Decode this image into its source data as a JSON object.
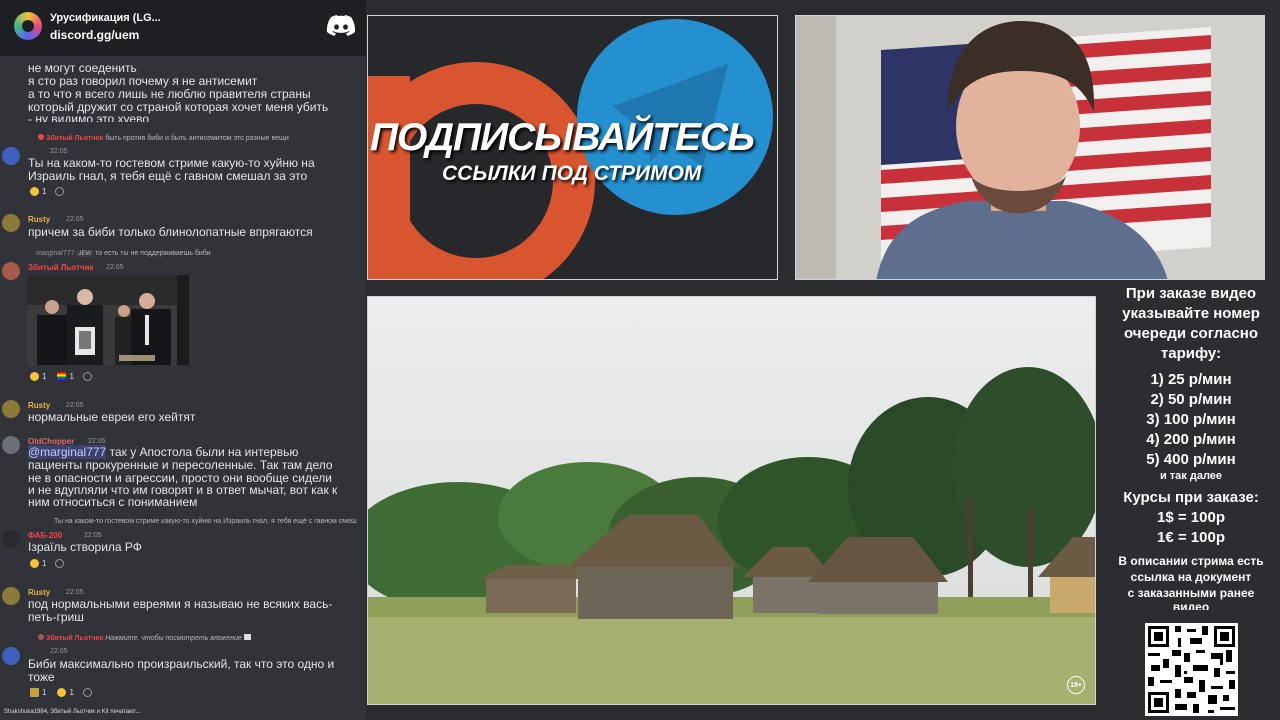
{
  "server": {
    "name": "Урусификация (LG...",
    "invite": "discord.gg/uem"
  },
  "chat": {
    "top_lines": [
      "не могут соеденить",
      "я сто раз говорил почему я не антисемит",
      "а то что я всего лишь не люблю правителя страны",
      "который дружит со страной которая хочет меня убить",
      "- ну видимо это хуево"
    ],
    "m1": {
      "reply_author": "Збитый Льотчик",
      "reply": "быть против биби и быть антисемитом это разные вещи",
      "time": "22:05",
      "lines": [
        "Ты на каком-то гостевом стриме какую-то хуйню на",
        "Израиль гнал, я тебя ещё с гавном смешал за это"
      ],
      "react_count": "1"
    },
    "m2": {
      "author": "Rusty",
      "time": "22:05",
      "text": "причем за биби только блинолопатные впрягаются"
    },
    "m3": {
      "reply_author": "marginal777",
      "reply_tag": "JEW",
      "reply": "то есть ты не поддерживаешь биби",
      "author": "Збитый Льотчик",
      "time": "22:05",
      "react1": "1",
      "react2": "1"
    },
    "m4": {
      "author": "Rusty",
      "time": "22:05",
      "text": "нормальные евреи его хейтят"
    },
    "m5": {
      "author": "OldChopper",
      "time": "22:05",
      "mention": "@marginal777",
      "lines_first": " так у Апостола были на интервью",
      "lines": [
        "пациенты прокуренные и пересоленные. Так там дело",
        "не в опасности и агрессии, просто они вообще сидели",
        "и не вдупляли что им говорят и в ответ мычат, вот как к",
        "ним относиться с пониманием"
      ]
    },
    "m6": {
      "reply": "Ты на каком-то гостевом стриме какую-то хуйню на Израиль гнал, я тебя ещё с гавном смеш",
      "author": "ФАБ-200",
      "time": "22:05",
      "text": "Ізраїль створила РФ",
      "react": "1"
    },
    "m7": {
      "author": "Rusty",
      "time": "22:05",
      "lines": [
        "под нормальными евреями я называю не всяких вась-",
        "петь-гриш"
      ]
    },
    "m8": {
      "reply_author": "Збитый Льотчик",
      "reply": "Нажмите, чтобы посмотреть вложение",
      "time": "22:05",
      "lines": [
        "Биби максимально произраильский, так что это одно и",
        "тоже"
      ],
      "react1": "1",
      "react2": "1"
    },
    "typing": "Shakshuka1984, Збитый Льотчик и Kit печатают..."
  },
  "promo": {
    "title": "ПОДПИСЫВАЙТЕСЬ",
    "subtitle": "ССЫЛКИ ПОД СТРИМОМ"
  },
  "video": {
    "badge": "18+"
  },
  "info": {
    "heading": [
      "При заказе видео",
      "указывайте номер",
      "очереди согласно",
      "тарифу:"
    ],
    "tariffs": [
      "1) 25 р/мин",
      "2) 50 р/мин",
      "3) 100 р/мин",
      "4) 200 р/мин",
      "5) 400 р/мин"
    ],
    "etc": "и так далее",
    "rates_title": "Курсы при заказе:",
    "rates": [
      "1$ = 100р",
      "1€ = 100р"
    ],
    "note": [
      "В описании стрима есть",
      "ссылка на документ",
      "с заказанными ранее",
      "видео"
    ]
  },
  "colors": {
    "chat_bg": "#313338",
    "header_bg": "#1e1f22",
    "panel_border": "#cfd2d6",
    "name_red": "#f04747",
    "name_gold": "#e6b34a",
    "telegram": "#229ed9",
    "patreon": "#e0502e"
  }
}
